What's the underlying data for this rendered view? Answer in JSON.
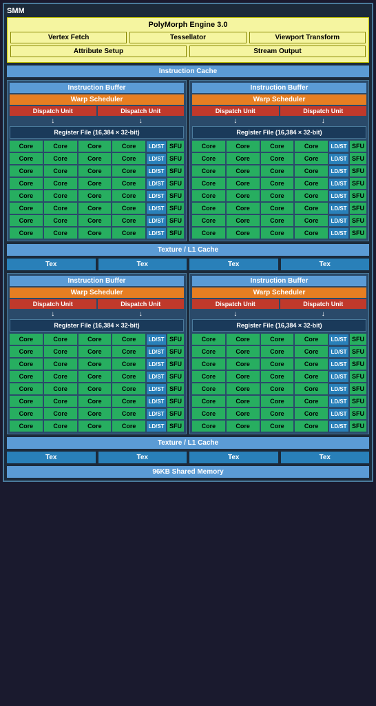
{
  "title": "SMM",
  "polymorph": {
    "title": "PolyMorph Engine 3.0",
    "row1": [
      "Vertex Fetch",
      "Tessellator",
      "Viewport Transform"
    ],
    "row2": [
      "Attribute Setup",
      "Stream Output"
    ]
  },
  "instruction_cache": "Instruction Cache",
  "texture_cache": "Texture / L1 Cache",
  "shared_memory": "96KB Shared Memory",
  "sm_block": {
    "instruction_buffer": "Instruction Buffer",
    "warp_scheduler": "Warp Scheduler",
    "dispatch_unit": "Dispatch Unit",
    "register_file": "Register File (16,384 × 32-bit)",
    "core_label": "Core",
    "ldst_label": "LD/ST",
    "sfu_label": "SFU",
    "tex_label": "Tex",
    "rows": 8
  }
}
